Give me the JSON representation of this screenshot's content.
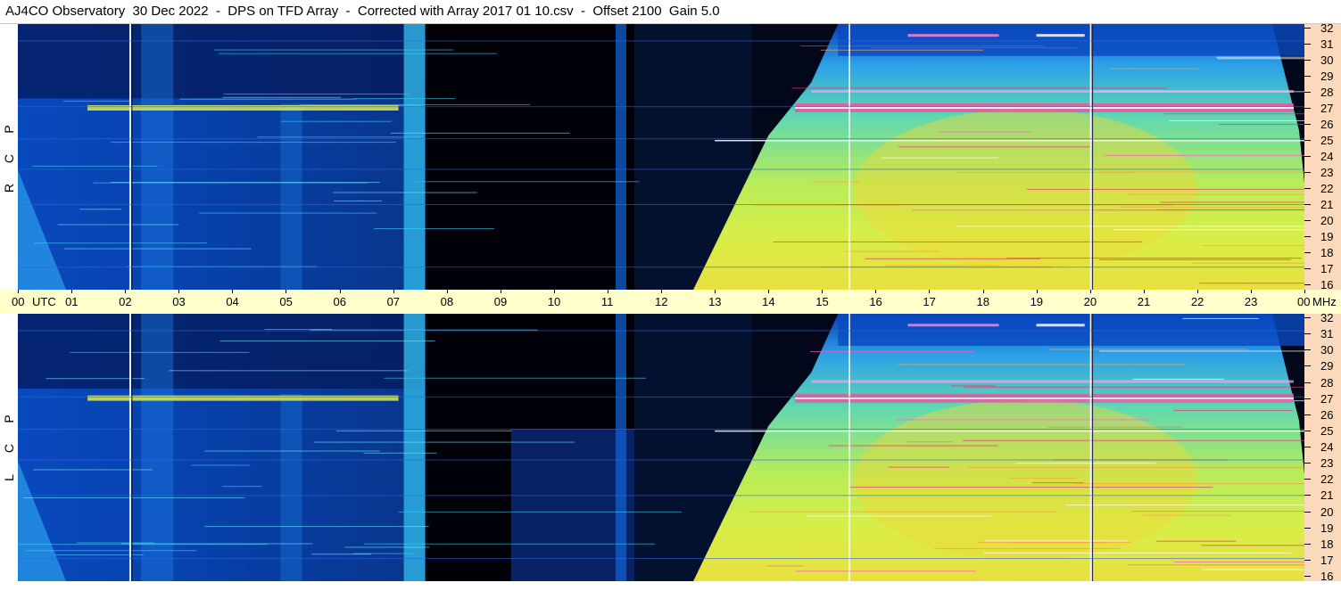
{
  "title": "AJ4CO Observatory  30 Dec 2022  -  DPS on TFD Array  -  Corrected with Array 2017 01 10.csv  -  Offset 2100  Gain 5.0",
  "panels": [
    {
      "polarization": [
        "R",
        "C",
        "P"
      ]
    },
    {
      "polarization": [
        "L",
        "C",
        "P"
      ]
    }
  ],
  "chart_data": {
    "type": "heatmap",
    "title": "AJ4CO Observatory  30 Dec 2022  -  DPS on TFD Array  -  Corrected with Array 2017 01 10.csv  -  Offset 2100  Gain 5.0",
    "x_axis": {
      "unit": "UTC",
      "range": [
        0,
        24
      ],
      "tick_labels": [
        "00",
        "01",
        "02",
        "03",
        "04",
        "05",
        "06",
        "07",
        "08",
        "09",
        "10",
        "11",
        "12",
        "13",
        "14",
        "15",
        "16",
        "17",
        "18",
        "19",
        "20",
        "21",
        "22",
        "23",
        "00"
      ],
      "start_label": "UTC"
    },
    "y_axis": {
      "unit": "MHz",
      "range": [
        16,
        32
      ],
      "tick_labels": [
        "16",
        "17",
        "18",
        "19",
        "20",
        "21",
        "22",
        "23",
        "24",
        "25",
        "26",
        "27",
        "28",
        "29",
        "30",
        "31",
        "32"
      ]
    },
    "series": [
      {
        "name": "RCP"
      },
      {
        "name": "LCP"
      }
    ],
    "colormap": [
      "#000010",
      "#001a5a",
      "#0a48c8",
      "#1e88f0",
      "#30c8e8",
      "#70e8a0",
      "#d8f040",
      "#f8d020",
      "#f86020",
      "#e81890",
      "#ffffff"
    ]
  },
  "colors": {
    "background": "#ffffff",
    "time_axis_bg": "#ffffcc",
    "freq_axis_bg": "#fbd9bd"
  }
}
